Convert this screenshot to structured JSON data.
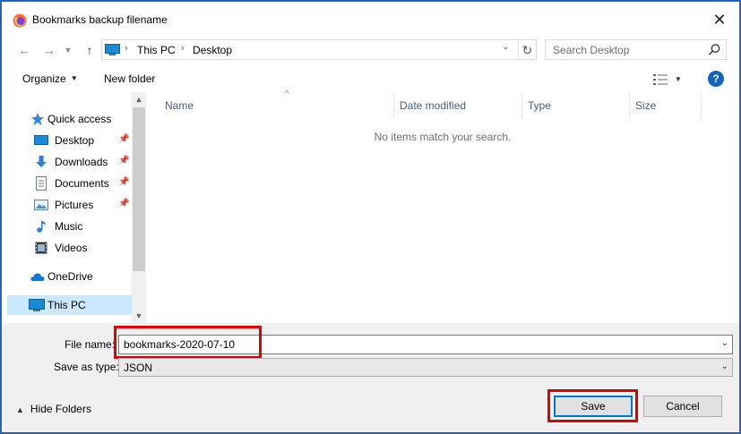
{
  "window": {
    "title": "Bookmarks backup filename",
    "icon": "firefox-icon"
  },
  "address_bar": {
    "breadcrumbs": [
      "This PC",
      "Desktop"
    ]
  },
  "search": {
    "placeholder": "Search Desktop"
  },
  "toolbar": {
    "organize_label": "Organize",
    "new_folder_label": "New folder",
    "help_label": "?"
  },
  "nav_pane": {
    "items": [
      {
        "label": "Quick access",
        "icon": "star-icon",
        "pinned": false
      },
      {
        "label": "Desktop",
        "icon": "desktop-icon",
        "pinned": true
      },
      {
        "label": "Downloads",
        "icon": "download-icon",
        "pinned": true
      },
      {
        "label": "Documents",
        "icon": "document-icon",
        "pinned": true
      },
      {
        "label": "Pictures",
        "icon": "picture-icon",
        "pinned": true
      },
      {
        "label": "Music",
        "icon": "music-icon",
        "pinned": false
      },
      {
        "label": "Videos",
        "icon": "video-icon",
        "pinned": false
      },
      {
        "label": "OneDrive",
        "icon": "cloud-icon",
        "pinned": false
      },
      {
        "label": "This PC",
        "icon": "computer-icon",
        "pinned": false,
        "selected": true
      }
    ]
  },
  "file_list": {
    "columns": [
      "Name",
      "Date modified",
      "Type",
      "Size"
    ],
    "empty_message": "No items match your search."
  },
  "form": {
    "file_name_label": "File name:",
    "file_name_value": "bookmarks-2020-07-10",
    "save_as_type_label": "Save as type:",
    "save_as_type_value": "JSON"
  },
  "footer": {
    "hide_folders_label": "Hide Folders",
    "save_label": "Save",
    "cancel_label": "Cancel"
  },
  "colors": {
    "highlight": "#e00000",
    "accent": "#0078d7",
    "selection": "#cce8ff"
  }
}
